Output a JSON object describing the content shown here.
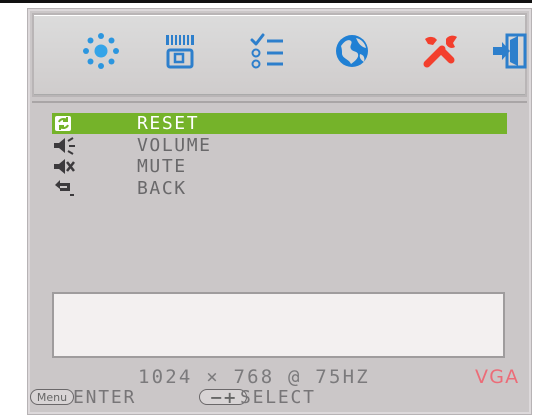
{
  "tabs": [
    {
      "icon": "brightness-icon",
      "color": "#2c96df"
    },
    {
      "icon": "screen-settings-icon",
      "color": "#2d7fcc"
    },
    {
      "icon": "checklist-icon",
      "color": "#2d7fcc"
    },
    {
      "icon": "globe-icon",
      "color": "#2080d4"
    },
    {
      "icon": "tools-icon",
      "color": "#f33f2d"
    },
    {
      "icon": "exit-icon",
      "color": "#2d7fcc"
    }
  ],
  "menu": {
    "items": [
      {
        "icon": "reset-icon",
        "label": "RESET",
        "selected": true
      },
      {
        "icon": "volume-icon",
        "label": "VOLUME",
        "selected": false
      },
      {
        "icon": "mute-icon",
        "label": "MUTE",
        "selected": false
      },
      {
        "icon": "back-icon",
        "label": "BACK",
        "selected": false
      }
    ]
  },
  "status": {
    "resolution": "1024 × 768 @ 75HZ",
    "signal": "VGA"
  },
  "footer": {
    "menu_button": "Menu",
    "enter_label": "ENTER",
    "select_button": "−+",
    "select_label": "SELECT"
  },
  "colors": {
    "osd_background": "#cbc7c8",
    "selected_item": "#75b32a",
    "signal_text": "#ec6c78"
  }
}
